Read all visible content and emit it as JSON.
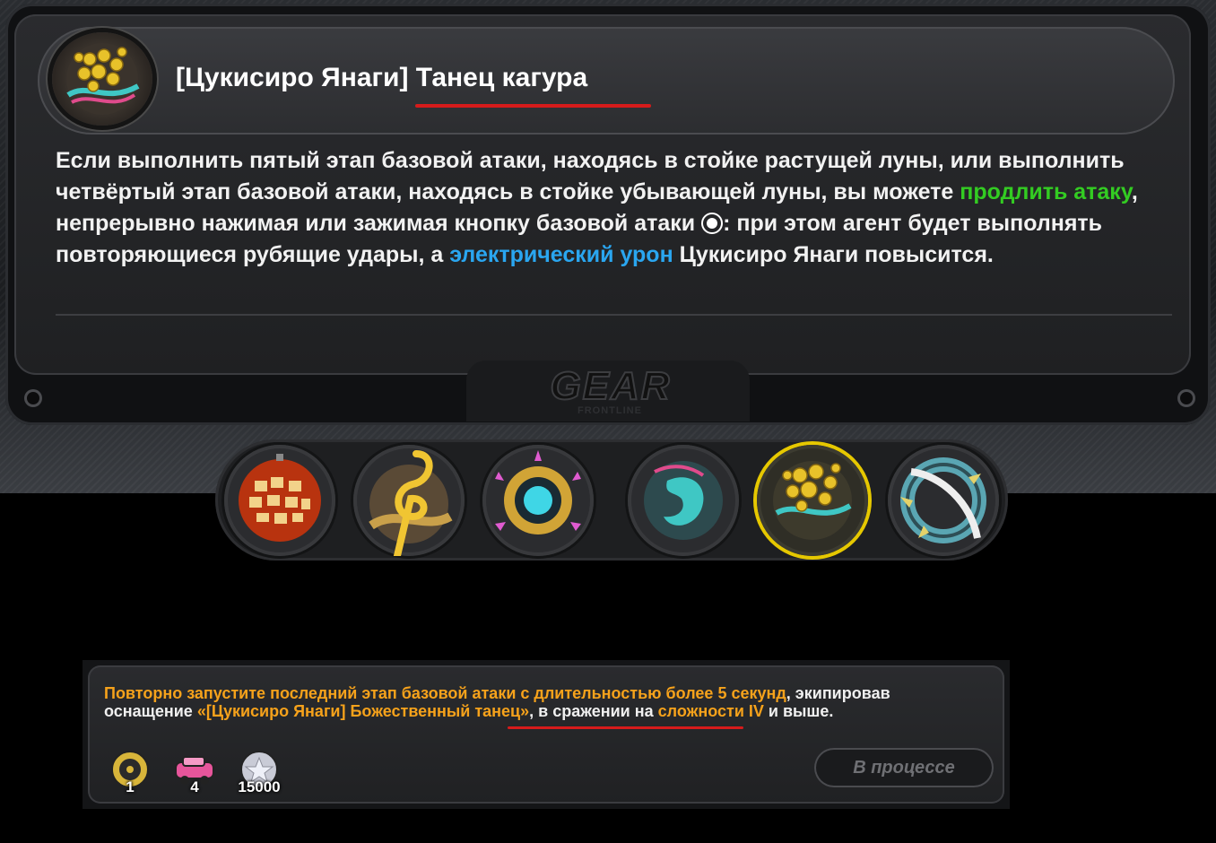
{
  "skill": {
    "title": "[Цукисиро Янаги] Танец кагура",
    "icon": "golden-ornament-skill-icon",
    "description": {
      "part1": "Если выполнить пятый этап базовой атаки, находясь в стойке растущей луны, или выполнить четвёртый этап базовой атаки, находясь в стойке убывающей луны, вы можете ",
      "highlight1": "продлить атаку",
      "part2": ", непрерывно нажимая или зажимая кнопку базовой атаки ",
      "button_glyph": "basic-attack-button-icon",
      "part3": ": при этом агент будет выполнять повторяющиеся рубящие удары, а ",
      "highlight2": "электрический урон",
      "part4": " Цукисиро Янаги повысится."
    }
  },
  "branding": {
    "logo": "GEAR",
    "sub": "FRONTLINE"
  },
  "icon_strip": {
    "items": [
      {
        "name": "disco-ball-icon",
        "active": false
      },
      {
        "name": "treble-clef-icon",
        "active": false
      },
      {
        "name": "star-compass-icon",
        "active": false
      },
      {
        "name": "magatama-icon",
        "active": false
      },
      {
        "name": "golden-ornament-icon",
        "active": true
      },
      {
        "name": "spiked-ring-icon",
        "active": false
      }
    ]
  },
  "achievement": {
    "line_a": "Повторно запустите последний этап базовой атаки с длительностью более 5 секунд",
    "line_b": ", экипировав оснащение ",
    "item_name": "«[Цукисиро Янаги] Божественный танец»",
    "line_c": ", в сражении на ",
    "difficulty": "сложности IV",
    "line_d": " и выше.",
    "rewards": [
      {
        "icon": "gold-record-icon",
        "count": "1"
      },
      {
        "icon": "pink-car-icon",
        "count": "4"
      },
      {
        "icon": "silver-coin-icon",
        "count": "15000"
      }
    ],
    "status": "В процессе"
  },
  "colors": {
    "accent_red": "#d61b1b",
    "highlight_green": "#33cc22",
    "highlight_blue": "#2aa6f0",
    "highlight_orange": "#f6a21b",
    "active_ring": "#e6c800"
  }
}
